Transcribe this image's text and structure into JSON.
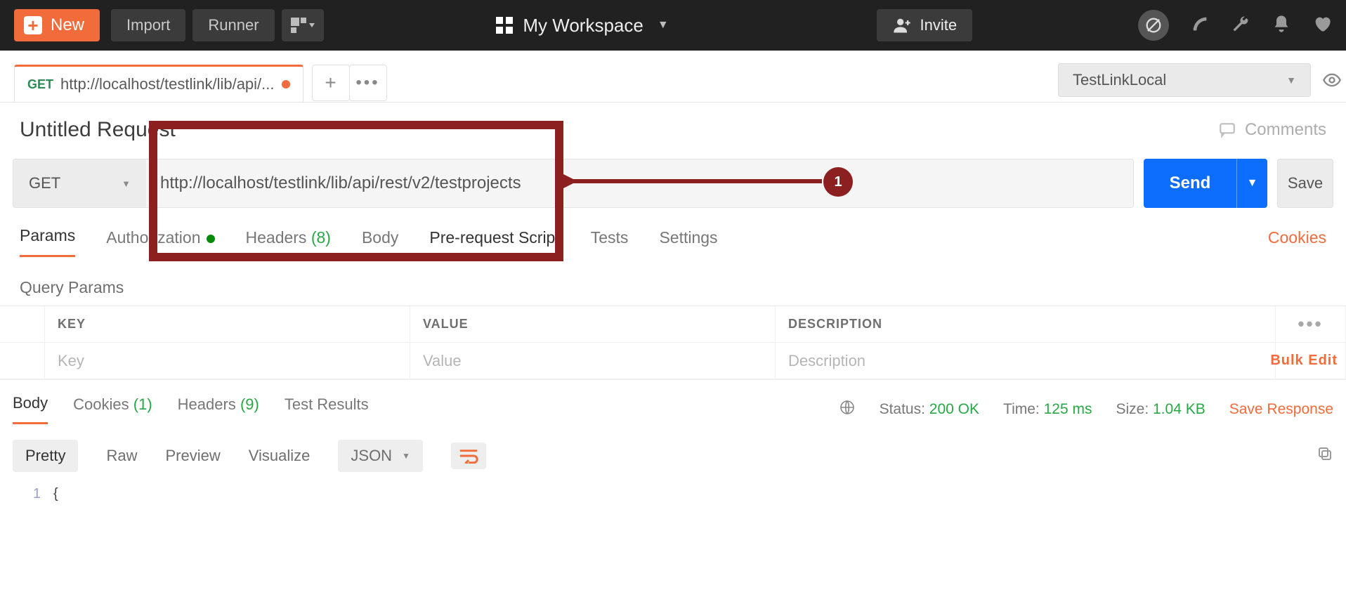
{
  "topbar": {
    "new_label": "New",
    "import_label": "Import",
    "runner_label": "Runner",
    "workspace_label": "My Workspace",
    "invite_label": "Invite"
  },
  "env": {
    "selected": "TestLinkLocal"
  },
  "tab": {
    "method": "GET",
    "title": "http://localhost/testlink/lib/api/..."
  },
  "request": {
    "name": "Untitled Request",
    "comments_label": "Comments",
    "method": "GET",
    "url": "http://localhost/testlink/lib/api/rest/v2/testprojects",
    "send_label": "Send",
    "save_label": "Save"
  },
  "reqtabs": {
    "params": "Params",
    "auth": "Authorization",
    "headers": "Headers",
    "headers_count": "(8)",
    "body": "Body",
    "prereq": "Pre-request Script",
    "tests": "Tests",
    "settings": "Settings",
    "cookies": "Cookies"
  },
  "query": {
    "label": "Query Params",
    "key_hdr": "KEY",
    "value_hdr": "VALUE",
    "desc_hdr": "DESCRIPTION",
    "key_ph": "Key",
    "value_ph": "Value",
    "desc_ph": "Description",
    "bulk": "Bulk Edit"
  },
  "resp": {
    "body": "Body",
    "cookies": "Cookies",
    "cookies_count": "(1)",
    "headers": "Headers",
    "headers_count": "(9)",
    "test_results": "Test Results",
    "status_label": "Status:",
    "status_value": "200 OK",
    "time_label": "Time:",
    "time_value": "125 ms",
    "size_label": "Size:",
    "size_value": "1.04 KB",
    "save_response": "Save Response"
  },
  "resptool": {
    "pretty": "Pretty",
    "raw": "Raw",
    "preview": "Preview",
    "visualize": "Visualize",
    "format": "JSON"
  },
  "code": {
    "line1_no": "1"
  },
  "annot": {
    "badge": "1"
  }
}
